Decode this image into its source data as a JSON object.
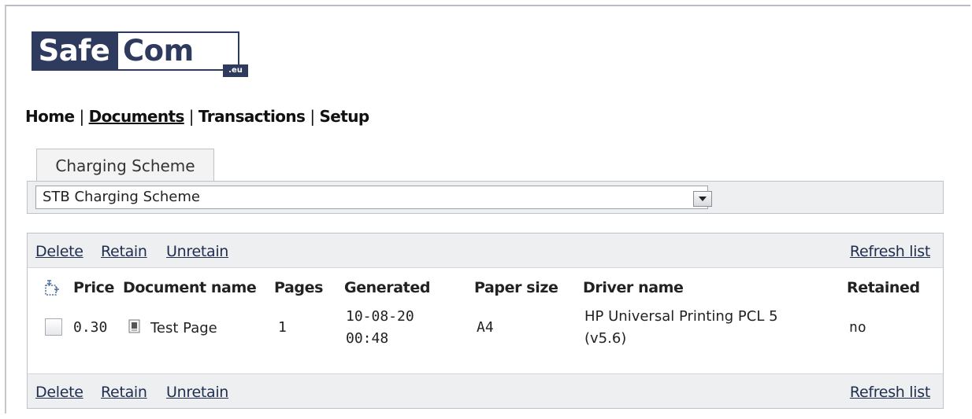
{
  "logo": {
    "part1": "Safe",
    "part2": "Com",
    "suffix": ".eu"
  },
  "nav": {
    "home": "Home",
    "documents": "Documents",
    "transactions": "Transactions",
    "setup": "Setup",
    "separator": "|"
  },
  "tab": {
    "label": "Charging Scheme"
  },
  "scheme_select": {
    "value": "STB Charging Scheme"
  },
  "toolbar": {
    "delete": "Delete",
    "retain": "Retain",
    "unretain": "Unretain",
    "refresh": "Refresh list"
  },
  "table": {
    "headers": [
      "Price",
      "Document name",
      "Pages",
      "Generated",
      "Paper size",
      "Driver name",
      "Retained"
    ],
    "rows": [
      {
        "price": "0.30",
        "document_name": "Test Page",
        "pages": "1",
        "generated_date": "10-08-20",
        "generated_time": "00:48",
        "paper_size": "A4",
        "driver_line1": "HP Universal Printing PCL 5",
        "driver_line2": "(v5.6)",
        "retained": "no"
      }
    ]
  },
  "icons": [
    "sort-icon",
    "document-icon",
    "dropdown-arrow-icon"
  ],
  "colors": {
    "brand": "#2f3a5f",
    "link": "#1f2d4e",
    "panel_bg": "#eeeff1"
  }
}
